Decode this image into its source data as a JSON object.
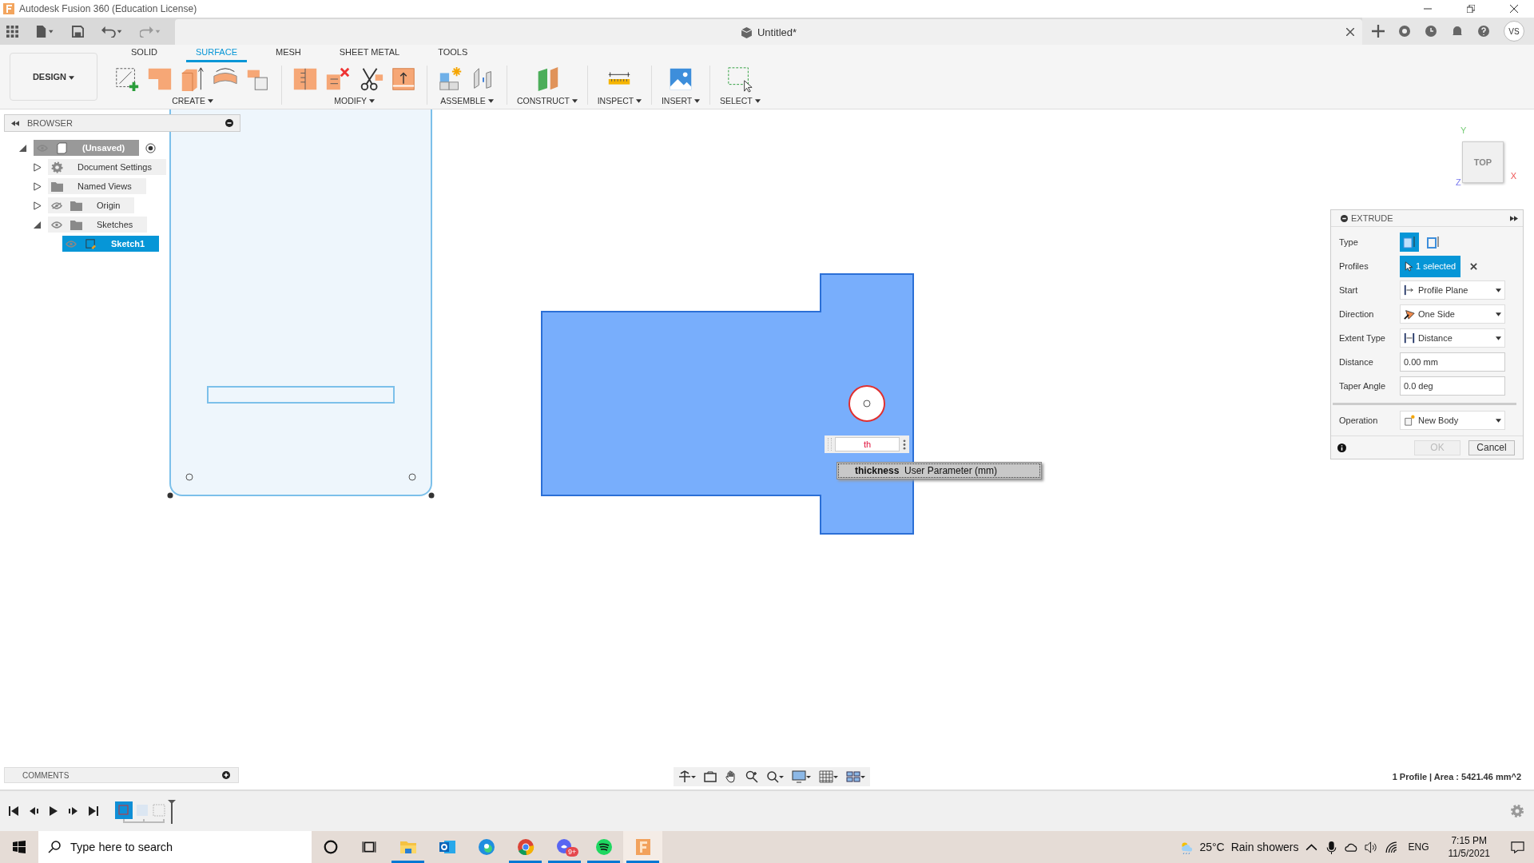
{
  "window": {
    "title": "Autodesk Fusion 360 (Education License)"
  },
  "document_tab": {
    "title": "Untitled*"
  },
  "user_badge": "VS",
  "workspace_button": "DESIGN",
  "tabs": [
    {
      "label": "SOLID",
      "selected": false
    },
    {
      "label": "SURFACE",
      "selected": true
    },
    {
      "label": "MESH",
      "selected": false
    },
    {
      "label": "SHEET METAL",
      "selected": false
    },
    {
      "label": "TOOLS",
      "selected": false
    }
  ],
  "toolbar_groups": [
    {
      "label": "CREATE",
      "tools": [
        {
          "kind": "sketch"
        },
        {
          "kind": "patch"
        },
        {
          "kind": "extrude"
        },
        {
          "kind": "revolve"
        },
        {
          "kind": "offset"
        }
      ]
    },
    {
      "label": "MODIFY",
      "tools": [
        {
          "kind": "split"
        },
        {
          "kind": "delete"
        },
        {
          "kind": "trim"
        },
        {
          "kind": "thicken"
        }
      ]
    },
    {
      "label": "ASSEMBLE",
      "tools": [
        {
          "kind": "component"
        },
        {
          "kind": "joint"
        }
      ]
    },
    {
      "label": "CONSTRUCT",
      "tools": [
        {
          "kind": "plane"
        }
      ]
    },
    {
      "label": "INSPECT",
      "tools": [
        {
          "kind": "measure"
        }
      ]
    },
    {
      "label": "INSERT",
      "tools": [
        {
          "kind": "image"
        }
      ]
    },
    {
      "label": "SELECT",
      "tools": [
        {
          "kind": "select"
        }
      ]
    }
  ],
  "browser": {
    "title": "BROWSER",
    "tree": [
      {
        "label": "(Unsaved)",
        "kind": "root",
        "visible": true,
        "expanded": true,
        "selected": false,
        "children": [
          {
            "label": "Document Settings",
            "kind": "settings",
            "expanded": false,
            "selected": false
          },
          {
            "label": "Named Views",
            "kind": "folder",
            "expanded": false,
            "selected": false
          },
          {
            "label": "Origin",
            "kind": "folder",
            "visible": false,
            "expanded": false,
            "selected": false
          },
          {
            "label": "Sketches",
            "kind": "folder",
            "visible": true,
            "expanded": true,
            "selected": false,
            "children": [
              {
                "label": "Sketch1",
                "kind": "sketch",
                "visible": true,
                "selected": true
              }
            ]
          }
        ]
      }
    ]
  },
  "sketch_input": {
    "value": "th"
  },
  "autocomplete": {
    "name": "thickness",
    "description": "User Parameter (mm)"
  },
  "view_cube": {
    "face": "TOP",
    "axes": [
      "Y",
      "X",
      "Z"
    ]
  },
  "extrude": {
    "title": "EXTRUDE",
    "rows": [
      {
        "label": "Type",
        "kind": "type",
        "options": [
          {
            "selected": true
          },
          {
            "selected": false
          }
        ]
      },
      {
        "label": "Profiles",
        "kind": "selection",
        "value": "1 selected"
      },
      {
        "label": "Start",
        "kind": "dropdown",
        "value": "Profile Plane"
      },
      {
        "label": "Direction",
        "kind": "dropdown",
        "value": "One Side"
      },
      {
        "label": "Extent Type",
        "kind": "dropdown",
        "value": "Distance"
      },
      {
        "label": "Distance",
        "kind": "input",
        "value": "0.00 mm"
      },
      {
        "label": "Taper Angle",
        "kind": "input",
        "value": "0.0 deg"
      },
      {
        "label": "Operation",
        "kind": "dropdown",
        "value": "New Body",
        "separated": true
      }
    ],
    "ok": {
      "label": "OK",
      "disabled": true
    },
    "cancel": {
      "label": "Cancel",
      "disabled": false
    }
  },
  "comments": {
    "title": "COMMENTS"
  },
  "status": "1 Profile | Area : 5421.46 mm^2",
  "taskbar": {
    "search_placeholder": "Type here to search",
    "apps": [
      {
        "kind": "explorer",
        "running": true,
        "selected": false
      },
      {
        "kind": "outlook",
        "running": false,
        "selected": false
      },
      {
        "kind": "edge",
        "running": false,
        "selected": false
      },
      {
        "kind": "chrome",
        "running": true,
        "selected": false
      },
      {
        "kind": "discord",
        "running": true,
        "selected": false,
        "badge": "9+"
      },
      {
        "kind": "spotify",
        "running": true,
        "selected": false
      },
      {
        "kind": "fusion",
        "running": true,
        "selected": true
      }
    ],
    "temperature": "25°C",
    "weather": "Rain showers",
    "language": "ENG",
    "time": "7:15 PM",
    "date": "11/5/2021"
  }
}
